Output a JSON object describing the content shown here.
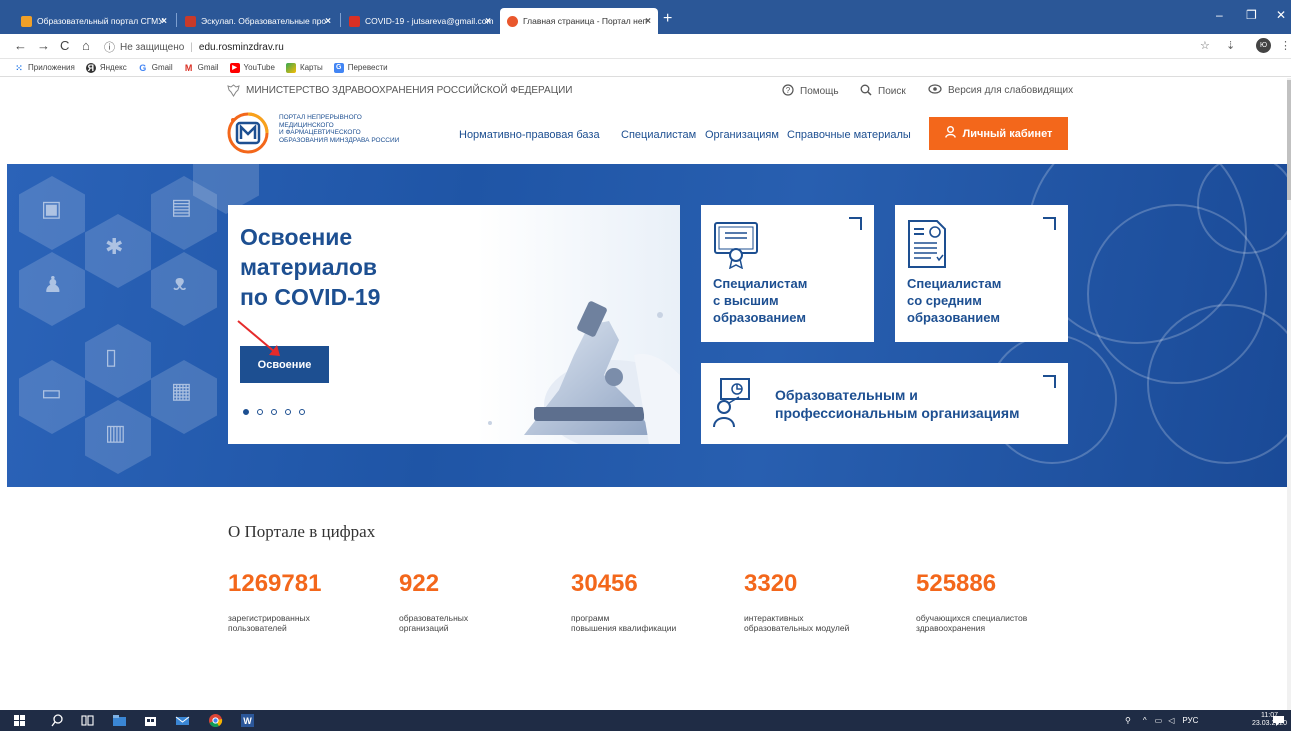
{
  "browser": {
    "tabs": [
      {
        "title": "Образовательный портал СГМУ",
        "favicon_color": "#f0a028"
      },
      {
        "title": "Эскулап. Образовательные про",
        "favicon_color": "#c83a2a"
      },
      {
        "title": "COVID-19 - jutsareva@gmail.com",
        "favicon_color": "#d93025"
      },
      {
        "title": "Главная страница - Портал неп",
        "favicon_color": "#e9572c"
      }
    ],
    "address": {
      "security_label": "Не защищено",
      "url": "edu.rosminzdrav.ru"
    },
    "profile_initial": "Ю",
    "bookmarks": [
      {
        "label": "Приложения",
        "color": "#1a73e8"
      },
      {
        "label": "Яндекс",
        "color": "#333333"
      },
      {
        "label": "Gmail",
        "color": "#4285f4"
      },
      {
        "label": "Gmail",
        "color": "#d93025"
      },
      {
        "label": "YouTube",
        "color": "#ff0000"
      },
      {
        "label": "Карты",
        "color": "#34a853"
      },
      {
        "label": "Перевести",
        "color": "#4285f4"
      }
    ]
  },
  "site": {
    "ministry": "МИНИСТЕРСТВО ЗДРАВООХРАНЕНИЯ РОССИЙСКОЙ ФЕДЕРАЦИИ",
    "top_links": {
      "help": "Помощь",
      "search": "Поиск",
      "accessibility": "Версия для слабовидящих"
    },
    "logo_lines": [
      "ПОРТАЛ НЕПРЕРЫВНОГО",
      "МЕДИЦИНСКОГО",
      "И ФАРМАЦЕВТИЧЕСКОГО",
      "ОБРАЗОВАНИЯ МИНЗДРАВА РОССИИ"
    ],
    "nav": [
      "Нормативно-правовая база",
      "Специалистам",
      "Организациям",
      "Справочные материалы"
    ],
    "cabinet_button": "Личный кабинет",
    "accent_color": "#f3671b",
    "brand_color": "#1d4f91"
  },
  "hero": {
    "slide": {
      "title_lines": [
        "Освоение",
        "материалов",
        "по COVID-19"
      ],
      "button": "Освоение",
      "slide_count": 5,
      "active_slide": 1
    },
    "cards": [
      {
        "lines": [
          "Специалистам",
          "с высшим",
          "образованием"
        ]
      },
      {
        "lines": [
          "Специалистам",
          "со средним",
          "образованием"
        ]
      },
      {
        "lines": [
          "Образовательным и",
          "профессиональным организациям"
        ]
      }
    ]
  },
  "stats": {
    "title": "О Портале в цифрах",
    "items": [
      {
        "value": "1269781",
        "label_lines": [
          "зарегистрированных",
          "пользователей"
        ]
      },
      {
        "value": "922",
        "label_lines": [
          "образовательных",
          "организаций"
        ]
      },
      {
        "value": "30456",
        "label_lines": [
          "программ",
          "повышения квалификации"
        ]
      },
      {
        "value": "3320",
        "label_lines": [
          "интерактивных",
          "образовательных модулей"
        ]
      },
      {
        "value": "525886",
        "label_lines": [
          "обучающихся специалистов",
          "здравоохранения"
        ]
      }
    ]
  },
  "taskbar": {
    "language": "РУС",
    "time": "11:07",
    "date": "23.03.2020"
  }
}
